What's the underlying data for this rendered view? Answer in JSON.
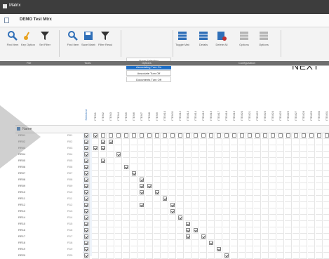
{
  "window": {
    "title": "Matrix"
  },
  "document": {
    "name": "DEMO Test Mtrx",
    "icon": "document-icon"
  },
  "ribbon": {
    "buttons": [
      {
        "id": "find",
        "label": "Find Item",
        "icon": "magnifier-icon",
        "color": "#2f6fb8"
      },
      {
        "id": "key",
        "label": "Key Options",
        "icon": "key-icon",
        "color": "#e8a220"
      },
      {
        "id": "filter1",
        "label": "Set Filter",
        "icon": "funnel-icon",
        "color": "#333333"
      },
      {
        "id": "find2",
        "label": "Find Item",
        "icon": "magnifier-icon",
        "color": "#2f6fb8"
      },
      {
        "id": "save",
        "label": "Save Matrix",
        "icon": "floppy-icon",
        "color": "#2f6fb8"
      },
      {
        "id": "filter2",
        "label": "Filter Results",
        "icon": "funnel-icon",
        "color": "#333333"
      },
      {
        "id": "toggle",
        "label": "Toggle Matrix",
        "icon": "grid-toggle-icon",
        "color": "#2f6fb8"
      },
      {
        "id": "details",
        "label": "Details",
        "icon": "details-icon",
        "color": "#2f6fb8"
      },
      {
        "id": "delete",
        "label": "Delete All",
        "icon": "delete-grid-icon",
        "color": "#c03030"
      },
      {
        "id": "opt1",
        "label": "Options",
        "icon": "grid-icon-disabled",
        "color": "#b5b5b5"
      },
      {
        "id": "opt2",
        "label": "Options",
        "icon": "grid-icon-disabled",
        "color": "#b5b5b5"
      }
    ],
    "presets": [
      {
        "label": "None Selecting",
        "selected": false
      },
      {
        "label": "Associating Turn On",
        "selected": true
      },
      {
        "label": "Associate Turn Off",
        "selected": false
      },
      {
        "label": "Documents Turn Off",
        "selected": false
      }
    ],
    "next": "NEXT",
    "groups": [
      "File",
      "Tools",
      "Options",
      "Configuration"
    ]
  },
  "grid": {
    "first_column_label": "Name",
    "selection_column": "Selected",
    "column_headers": [
      "ITEM1",
      "ITEM2",
      "ITEM3",
      "ITEM4",
      "ITEM5",
      "ITEM6",
      "ITEM7",
      "ITEM8",
      "ITEM9",
      "ITEM10",
      "ITEM11",
      "ITEM12",
      "ITEM13",
      "ITEM14",
      "ITEM15",
      "ITEM16",
      "ITEM17",
      "ITEM18",
      "ITEM19",
      "ITEM20",
      "ITEM21",
      "ITEM22",
      "ITEM23",
      "ITEM24",
      "ITEM25",
      "ITEM26",
      "ITEM27",
      "ITEM28",
      "ITEM29",
      "ITEM30",
      "ITEM31"
    ],
    "rows": [
      {
        "name": "RR01",
        "value": "R01",
        "checked": [
          0,
          1
        ]
      },
      {
        "name": "RR02",
        "value": "R02",
        "checked": [
          0,
          2,
          3
        ]
      },
      {
        "name": "RR03",
        "value": "R03",
        "checked": [
          0,
          1,
          2
        ]
      },
      {
        "name": "RR04",
        "value": "R04",
        "checked": [
          0,
          4
        ]
      },
      {
        "name": "RR05",
        "value": "R05",
        "checked": [
          0,
          2
        ]
      },
      {
        "name": "RR06",
        "value": "R06",
        "checked": [
          0,
          5
        ]
      },
      {
        "name": "RR07",
        "value": "R07",
        "checked": [
          0,
          6
        ]
      },
      {
        "name": "RR08",
        "value": "R08",
        "checked": [
          0,
          7
        ]
      },
      {
        "name": "RR09",
        "value": "R09",
        "checked": [
          0,
          7,
          8
        ]
      },
      {
        "name": "RR10",
        "value": "R10",
        "checked": [
          0,
          7,
          9
        ]
      },
      {
        "name": "RR11",
        "value": "R11",
        "checked": [
          0,
          10
        ]
      },
      {
        "name": "RR12",
        "value": "R12",
        "checked": [
          0,
          7,
          11
        ]
      },
      {
        "name": "RR13",
        "value": "R13",
        "checked": [
          0,
          11
        ]
      },
      {
        "name": "RR14",
        "value": "R14",
        "checked": [
          0,
          12
        ]
      },
      {
        "name": "RR15",
        "value": "R15",
        "checked": [
          0,
          13
        ]
      },
      {
        "name": "RR16",
        "value": "R16",
        "checked": [
          0,
          13,
          14
        ]
      },
      {
        "name": "RR17",
        "value": "R17",
        "checked": [
          0,
          13,
          15
        ]
      },
      {
        "name": "RR18",
        "value": "R18",
        "checked": [
          0,
          16
        ]
      },
      {
        "name": "RR19",
        "value": "R19",
        "checked": [
          0,
          17
        ]
      },
      {
        "name": "RR20",
        "value": "R20",
        "checked": [
          0,
          18
        ]
      }
    ]
  },
  "overlay": {
    "icon": "play-arrow-icon"
  }
}
